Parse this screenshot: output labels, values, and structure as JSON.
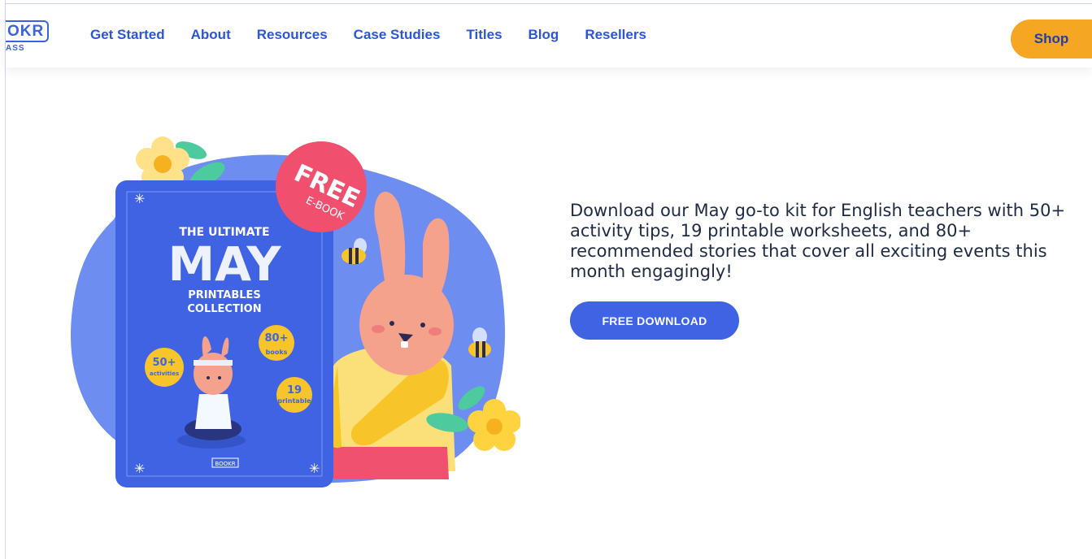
{
  "brand": {
    "logo_text": "OKR",
    "logo_sub": "ASS"
  },
  "nav": {
    "items": [
      "Get Started",
      "About",
      "Resources",
      "Case Studies",
      "Titles",
      "Blog",
      "Resellers"
    ],
    "shop_label": "Shop"
  },
  "hero": {
    "badge_line1": "FREE",
    "badge_line2": "E-BOOK",
    "book": {
      "kicker": "THE ULTIMATE",
      "title": "MAY",
      "subtitle_line1": "PRINTABLES",
      "subtitle_line2": "COLLECTION",
      "stat1_value": "50+",
      "stat1_label": "activities",
      "stat2_value": "80+",
      "stat2_label": "books",
      "stat3_value": "19",
      "stat3_label": "printable",
      "footer_logo": "BOOKR"
    },
    "description": "Download our May go-to kit for English teachers with 50+ activity tips, 19 printable worksheets, and 80+ recommended stories that cover all exciting events this month engagingly!",
    "cta_label": "FREE DOWNLOAD"
  },
  "colors": {
    "brand_blue": "#2c56d6",
    "shop_orange": "#f5a623",
    "cta_blue": "#3f63e3",
    "blob_blue": "#6d8df0"
  }
}
